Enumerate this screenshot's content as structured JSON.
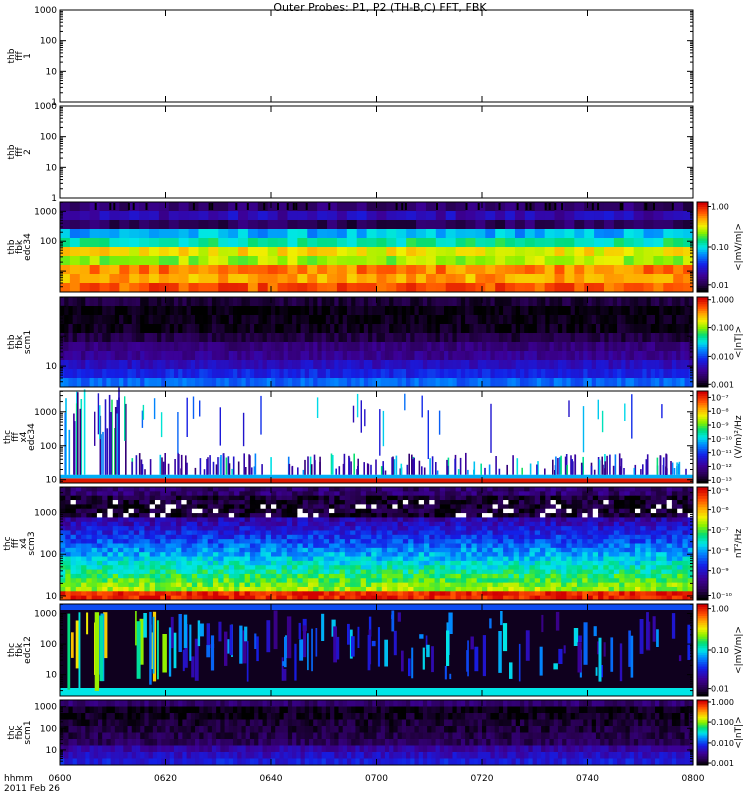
{
  "page": {
    "title": "Outer Probes: P1, P2 (TH-B,C) FFT, FBK"
  },
  "time_axis": {
    "label_line1": "hhmm",
    "label_line2": "2011 Feb 26",
    "range_minutes": [
      360,
      480
    ],
    "ticks": [
      {
        "minute": 360,
        "label": "0600"
      },
      {
        "minute": 380,
        "label": "0620"
      },
      {
        "minute": 400,
        "label": "0640"
      },
      {
        "minute": 420,
        "label": "0700"
      },
      {
        "minute": 440,
        "label": "0720"
      },
      {
        "minute": 460,
        "label": "0740"
      },
      {
        "minute": 480,
        "label": "0800"
      }
    ]
  },
  "chart_data": [
    {
      "type": "heatmap",
      "panel": "thb-ffp-1",
      "ylabel_lines": [
        "thb",
        "fff",
        "1"
      ],
      "yscale": "log",
      "ylim": [
        1,
        1000
      ],
      "yticks": [
        {
          "v": 1,
          "label": "1"
        },
        {
          "v": 10,
          "label": "10"
        },
        {
          "v": 100,
          "label": "100"
        },
        {
          "v": 1000,
          "label": "1000"
        }
      ],
      "empty": true,
      "colorbar": null
    },
    {
      "type": "heatmap",
      "panel": "thb-ffp-2",
      "ylabel_lines": [
        "thb",
        "fff",
        "2"
      ],
      "yscale": "log",
      "ylim": [
        1,
        1000
      ],
      "yticks": [
        {
          "v": 1,
          "label": "1"
        },
        {
          "v": 10,
          "label": "10"
        },
        {
          "v": 100,
          "label": "100"
        },
        {
          "v": 1000,
          "label": "1000"
        }
      ],
      "empty": true,
      "colorbar": null
    },
    {
      "type": "heatmap",
      "panel": "thb-fbk-edc34",
      "ylabel_lines": [
        "thb",
        "fbk",
        "edc34"
      ],
      "yscale": "log",
      "ylim": [
        2,
        2048
      ],
      "yticks": [
        {
          "v": 100,
          "label": "100"
        },
        {
          "v": 1000,
          "label": "1000"
        }
      ],
      "columns": 64,
      "bands": [
        {
          "f": [
            1024,
            2048
          ],
          "lvl": 0.12
        },
        {
          "f": [
            512,
            1024
          ],
          "lvl": 0.22
        },
        {
          "f": [
            256,
            512
          ],
          "lvl": 0.1
        },
        {
          "f": [
            128,
            256
          ],
          "lvl": 0.45
        },
        {
          "f": [
            64,
            128
          ],
          "lvl": 0.55
        },
        {
          "f": [
            32,
            64
          ],
          "lvl": 0.75
        },
        {
          "f": [
            16,
            32
          ],
          "lvl": 0.68
        },
        {
          "f": [
            8,
            16
          ],
          "lvl": 0.86
        },
        {
          "f": [
            4,
            8
          ],
          "lvl": 0.82
        },
        {
          "f": [
            2,
            4
          ],
          "lvl": 0.9
        }
      ],
      "variation": 0.06,
      "colorbar": {
        "label": "<|mV/m|>",
        "ticks": [
          {
            "pos": 0.95,
            "label": "1.00"
          },
          {
            "pos": 0.5,
            "label": "0.10"
          },
          {
            "pos": 0.08,
            "label": "0.01"
          }
        ]
      }
    },
    {
      "type": "heatmap",
      "panel": "thb-fbk-scm1",
      "ylabel_lines": [
        "thb",
        "fbk",
        "scm1"
      ],
      "yscale": "log",
      "ylim": [
        2,
        2048
      ],
      "yticks": [
        {
          "v": 10,
          "label": "10"
        }
      ],
      "columns": 150,
      "bands": [
        {
          "f": [
            1024,
            2048
          ],
          "lvl": 0.06
        },
        {
          "f": [
            512,
            1024
          ],
          "lvl": 0.01
        },
        {
          "f": [
            256,
            512
          ],
          "lvl": 0.02
        },
        {
          "f": [
            128,
            256
          ],
          "lvl": 0.03
        },
        {
          "f": [
            64,
            128
          ],
          "lvl": 0.07
        },
        {
          "f": [
            32,
            64
          ],
          "lvl": 0.14
        },
        {
          "f": [
            16,
            32
          ],
          "lvl": 0.17
        },
        {
          "f": [
            8,
            16
          ],
          "lvl": 0.24
        },
        {
          "f": [
            4,
            8
          ],
          "lvl": 0.3
        },
        {
          "f": [
            2,
            4
          ],
          "lvl": 0.38
        }
      ],
      "variation": 0.04,
      "colorbar": {
        "label": "<|nT|>",
        "ticks": [
          {
            "pos": 0.97,
            "label": "1.000"
          },
          {
            "pos": 0.66,
            "label": "0.100"
          },
          {
            "pos": 0.34,
            "label": "0.010"
          },
          {
            "pos": 0.03,
            "label": "0.001"
          }
        ]
      }
    },
    {
      "type": "heatmap",
      "panel": "thc-ffp-edc34",
      "ylabel_lines": [
        "thc",
        "fff",
        "x4",
        "edc34"
      ],
      "yscale": "log",
      "ylim": [
        8,
        4096
      ],
      "yticks": [
        {
          "v": 10,
          "label": "10"
        },
        {
          "v": 100,
          "label": "100"
        },
        {
          "v": 1000,
          "label": "1000"
        }
      ],
      "style": "sparse",
      "colorbar": {
        "label": "(V/m)²/Hz",
        "ticks": [
          {
            "pos": 0.93,
            "label": "10⁻⁷"
          },
          {
            "pos": 0.78,
            "label": "10⁻⁸"
          },
          {
            "pos": 0.63,
            "label": "10⁻⁹"
          },
          {
            "pos": 0.48,
            "label": "10⁻¹⁰"
          },
          {
            "pos": 0.33,
            "label": "10⁻¹¹"
          },
          {
            "pos": 0.18,
            "label": "10⁻¹²"
          },
          {
            "pos": 0.03,
            "label": "10⁻¹³"
          }
        ]
      }
    },
    {
      "type": "heatmap",
      "panel": "thc-ffp-scm3",
      "ylabel_lines": [
        "thc",
        "fff",
        "x4",
        "scm3"
      ],
      "yscale": "log",
      "ylim": [
        8,
        4096
      ],
      "yticks": [
        {
          "v": 10,
          "label": "10"
        },
        {
          "v": 100,
          "label": "100"
        },
        {
          "v": 1000,
          "label": "1000"
        }
      ],
      "style": "noisy",
      "colorbar": {
        "label": "nT²/Hz",
        "ticks": [
          {
            "pos": 0.97,
            "label": "10⁻⁵"
          },
          {
            "pos": 0.8,
            "label": "10⁻⁶"
          },
          {
            "pos": 0.62,
            "label": "10⁻⁷"
          },
          {
            "pos": 0.44,
            "label": "10⁻⁸"
          },
          {
            "pos": 0.26,
            "label": "10⁻⁹"
          },
          {
            "pos": 0.04,
            "label": "10⁻¹⁰"
          }
        ]
      }
    },
    {
      "type": "heatmap",
      "panel": "thc-fbk-edc12",
      "ylabel_lines": [
        "thc",
        "fbk",
        "edc12"
      ],
      "yscale": "log",
      "ylim": [
        2,
        2048
      ],
      "yticks": [
        {
          "v": 10,
          "label": "10"
        },
        {
          "v": 100,
          "label": "100"
        },
        {
          "v": 1000,
          "label": "1000"
        }
      ],
      "style": "patchy",
      "colorbar": {
        "label": "<|mV/m|>",
        "ticks": [
          {
            "pos": 0.95,
            "label": "1.00"
          },
          {
            "pos": 0.5,
            "label": "0.10"
          },
          {
            "pos": 0.08,
            "label": "0.01"
          }
        ]
      }
    },
    {
      "type": "heatmap",
      "panel": "thc-fbk-scm1",
      "ylabel_lines": [
        "thc",
        "fbk",
        "scm1"
      ],
      "yscale": "log",
      "ylim": [
        2,
        2048
      ],
      "yticks": [
        {
          "v": 10,
          "label": "10"
        },
        {
          "v": 100,
          "label": "100"
        },
        {
          "v": 1000,
          "label": "1000"
        }
      ],
      "columns": 150,
      "bands": [
        {
          "f": [
            1024,
            2048
          ],
          "lvl": 0.12
        },
        {
          "f": [
            512,
            1024
          ],
          "lvl": 0.02
        },
        {
          "f": [
            256,
            512
          ],
          "lvl": 0.03
        },
        {
          "f": [
            128,
            256
          ],
          "lvl": 0.05
        },
        {
          "f": [
            64,
            128
          ],
          "lvl": 0.06
        },
        {
          "f": [
            32,
            64
          ],
          "lvl": 0.08
        },
        {
          "f": [
            16,
            32
          ],
          "lvl": 0.1
        },
        {
          "f": [
            8,
            16
          ],
          "lvl": 0.19
        },
        {
          "f": [
            4,
            8
          ],
          "lvl": 0.24
        },
        {
          "f": [
            2,
            4
          ],
          "lvl": 0.28
        }
      ],
      "variation": 0.05,
      "colorbar": {
        "label": "<|nT|>",
        "ticks": [
          {
            "pos": 0.97,
            "label": "1.000"
          },
          {
            "pos": 0.66,
            "label": "0.100"
          },
          {
            "pos": 0.34,
            "label": "0.010"
          },
          {
            "pos": 0.03,
            "label": "0.001"
          }
        ]
      }
    }
  ]
}
